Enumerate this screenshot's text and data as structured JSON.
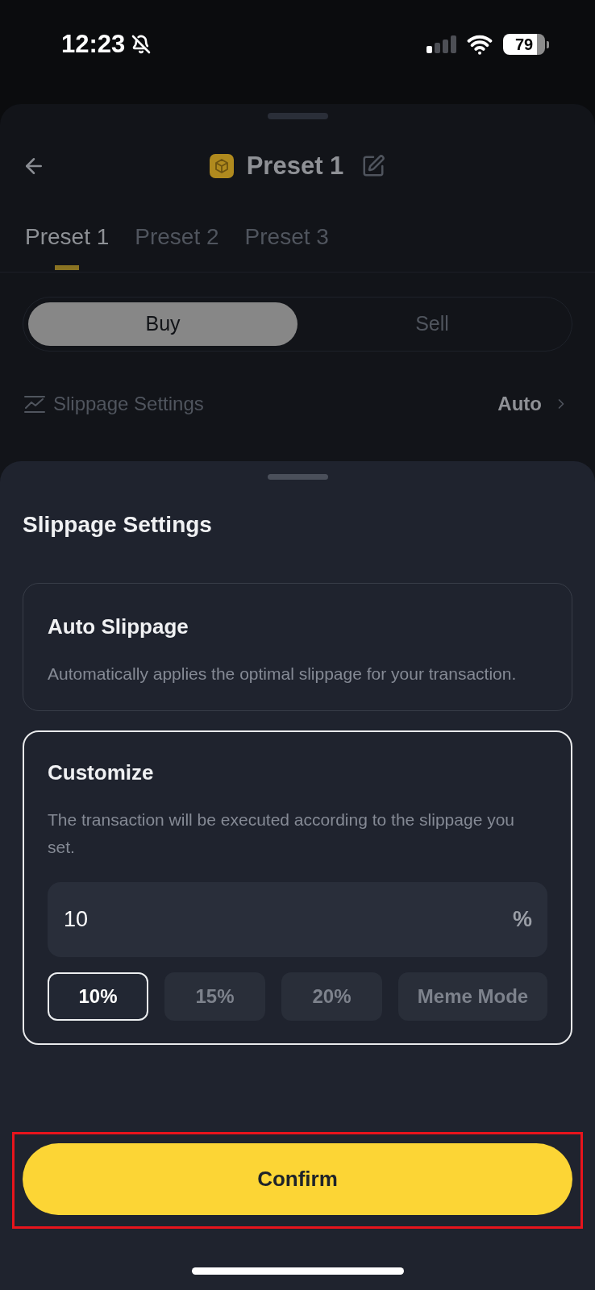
{
  "status_bar": {
    "time": "12:23",
    "battery": "79"
  },
  "background_screen": {
    "title": "Preset 1",
    "tabs": [
      {
        "label": "Preset 1",
        "selected": true
      },
      {
        "label": "Preset 2",
        "selected": false
      },
      {
        "label": "Preset 3",
        "selected": false
      }
    ],
    "side_toggle": [
      {
        "label": "Buy",
        "selected": true
      },
      {
        "label": "Sell",
        "selected": false
      }
    ],
    "slippage_row": {
      "label": "Slippage Settings",
      "value": "Auto"
    }
  },
  "sheet": {
    "title": "Slippage Settings",
    "options": [
      {
        "kind": "auto",
        "title": "Auto Slippage",
        "description": "Automatically applies the optimal slippage for your transaction.",
        "selected": false
      },
      {
        "kind": "custom",
        "title": "Customize",
        "description": "The transaction will be executed according to the slippage you set.",
        "selected": true,
        "field": {
          "value": "10",
          "unit": "%"
        },
        "presets": [
          {
            "label": "10%",
            "selected": true
          },
          {
            "label": "15%",
            "selected": false
          },
          {
            "label": "20%",
            "selected": false
          },
          {
            "label": "Meme Mode",
            "selected": false
          }
        ]
      }
    ],
    "confirm_button": {
      "label": "Confirm",
      "highlighted": true
    }
  }
}
